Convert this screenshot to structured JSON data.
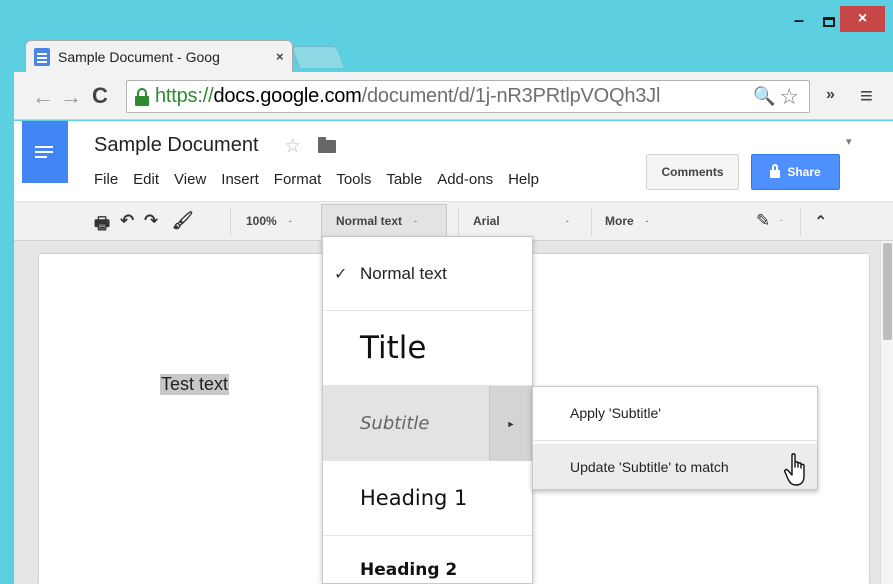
{
  "browser": {
    "tab_title": "Sample Document - Goog",
    "tab_close": "×",
    "url_scheme": "https://",
    "url_domain": "docs.google.com",
    "url_path": "/document/d/1j-nR3PRtlpVOQh3Jl",
    "window_controls": {
      "minimize": "–",
      "close": "×"
    },
    "icons": [
      "back-icon",
      "forward-icon",
      "reload-icon",
      "lock-icon",
      "zoom-icon",
      "star-icon",
      "extensions-icon",
      "menu-icon"
    ],
    "glyphs": {
      "back": "←",
      "forward": "→",
      "reload": "C",
      "zoom": "🔍",
      "star": "☆",
      "extensions": "»",
      "menu": "≡"
    }
  },
  "docs": {
    "title": "Sample Document",
    "star_glyph": "☆",
    "chevron_glyph": "▾",
    "menu": [
      "File",
      "Edit",
      "View",
      "Insert",
      "Format",
      "Tools",
      "Table",
      "Add-ons",
      "Help"
    ],
    "comments_label": "Comments",
    "share_label": "Share",
    "accent_color": "#4285f4"
  },
  "toolbar": {
    "zoom": "100%",
    "style": "Normal text",
    "font": "Arial",
    "more": "More",
    "caret": "-",
    "glyphs": {
      "print": "🖶",
      "undo": "↶",
      "redo": "↷",
      "paint_format": "🖌",
      "pen": "✎",
      "collapse": "⌃"
    }
  },
  "document": {
    "selected_text": "Test text"
  },
  "styles_menu": {
    "check": "✓",
    "options": [
      "Normal text",
      "Title",
      "Subtitle",
      "Heading 1",
      "Heading 2"
    ],
    "selected": "Normal text",
    "highlighted": "Subtitle",
    "submenu_arrow": "►"
  },
  "submenu": {
    "items": [
      "Apply 'Subtitle'",
      "Update 'Subtitle' to match"
    ]
  }
}
